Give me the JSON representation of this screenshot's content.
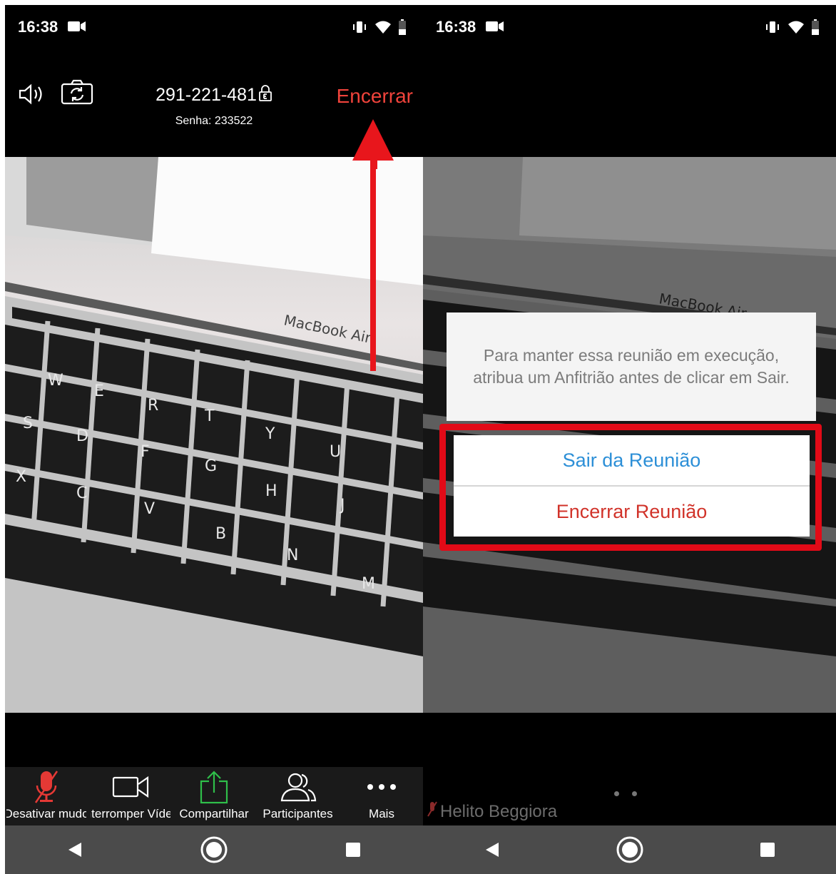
{
  "left": {
    "status": {
      "time": "16:38"
    },
    "meeting": {
      "id": "291-221-481",
      "password_label": "Senha: 233522",
      "end_label": "Encerrar"
    },
    "video": {
      "brand_text": "MacBook Air"
    },
    "toolbar": [
      {
        "label": "Desativar mudo",
        "icon": "mic-muted-icon"
      },
      {
        "label": "Interromper Vídeo",
        "icon": "video-camera-icon"
      },
      {
        "label": "Compartilhar",
        "icon": "share-icon"
      },
      {
        "label": "Participantes",
        "icon": "participants-icon"
      },
      {
        "label": "Mais",
        "icon": "more-icon"
      }
    ]
  },
  "right": {
    "status": {
      "time": "16:38"
    },
    "video": {
      "brand_text": "MacBook Air"
    },
    "dialog": {
      "message": "Para manter essa reunião em execução, atribua um Anfitrião antes de clicar em Sair.",
      "leave_label": "Sair da Reunião",
      "end_label": "Encerrar Reunião"
    },
    "user_name": "Helito Beggiora"
  },
  "colors": {
    "end_red": "#f0433b",
    "leave_blue": "#2c8fd7",
    "highlight_red": "#e20a17",
    "share_green": "#2fbf4a"
  }
}
